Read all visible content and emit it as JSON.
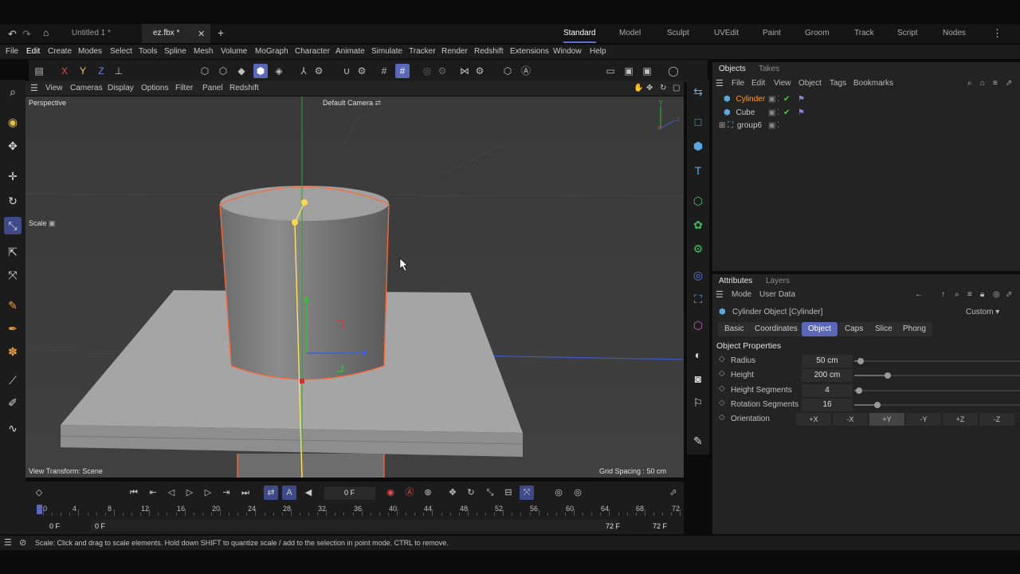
{
  "tabs": [
    {
      "label": "Untitled 1 *"
    },
    {
      "label": "ez.fbx *"
    }
  ],
  "layouts": [
    "Standard",
    "Model",
    "Sculpt",
    "UVEdit",
    "Paint",
    "Groom",
    "Track",
    "Script",
    "Nodes"
  ],
  "menus": [
    "File",
    "Edit",
    "Create",
    "Modes",
    "Select",
    "Tools",
    "Spline",
    "Mesh",
    "Volume",
    "MoGraph",
    "Character",
    "Animate",
    "Simulate",
    "Tracker",
    "Render",
    "Redshift",
    "Extensions",
    "Window",
    "Help"
  ],
  "axis_locks": [
    "X",
    "Y",
    "Z"
  ],
  "viewport": {
    "menus": [
      "View",
      "Cameras",
      "Display",
      "Options",
      "Filter",
      "Panel",
      "Redshift"
    ],
    "name": "Perspective",
    "camera": "Default Camera",
    "tool_label": "Scale",
    "view_transform": "View Transform: Scene",
    "grid_spacing": "Grid Spacing : 50 cm"
  },
  "objects_panel": {
    "tabs": [
      "Objects",
      "Takes"
    ],
    "menus": [
      "File",
      "Edit",
      "View",
      "Object",
      "Tags",
      "Bookmarks"
    ],
    "items": [
      {
        "name": "Cylinder"
      },
      {
        "name": "Cube"
      },
      {
        "name": "group6"
      }
    ]
  },
  "attributes_panel": {
    "tabs": [
      "Attributes",
      "Layers"
    ],
    "menus": [
      "Mode",
      "User Data"
    ],
    "object_title": "Cylinder Object [Cylinder]",
    "preset": "Custom",
    "subtabs": [
      "Basic",
      "Coordinates",
      "Object",
      "Caps",
      "Slice",
      "Phong"
    ],
    "section": "Object Properties",
    "properties": [
      {
        "label": "Radius",
        "value": "50 cm",
        "level": 0.04
      },
      {
        "label": "Height",
        "value": "200 cm",
        "level": 0.2
      },
      {
        "label": "Height Segments",
        "value": "4",
        "level": 0.03
      },
      {
        "label": "Rotation Segments",
        "value": "16",
        "level": 0.14
      }
    ],
    "orientation_label": "Orientation",
    "orientation": [
      "+X",
      "-X",
      "+Y",
      "-Y",
      "+Z",
      "-Z"
    ],
    "orientation_selected": "+Y"
  },
  "timeline": {
    "current_frame": "0 F",
    "ticks": [
      "0",
      "4",
      "8",
      "12",
      "16",
      "20",
      "24",
      "28",
      "32",
      "36",
      "40",
      "44",
      "48",
      "52",
      "56",
      "60",
      "64",
      "68",
      "72"
    ],
    "range_start": "0 F",
    "range_start2": "0 F",
    "range_end": "72 F",
    "range_end2": "72 F"
  },
  "status": "Scale: Click and drag to scale elements. Hold down SHIFT to quantize scale / add to the selection in point mode. CTRL to remove.",
  "colors": {
    "accent": "#5b67b8",
    "selection": "#ff6a3d",
    "x_axis": "#d04040",
    "y_axis": "#40c040",
    "z_axis": "#4060d0",
    "highlight": "#ffe066"
  }
}
